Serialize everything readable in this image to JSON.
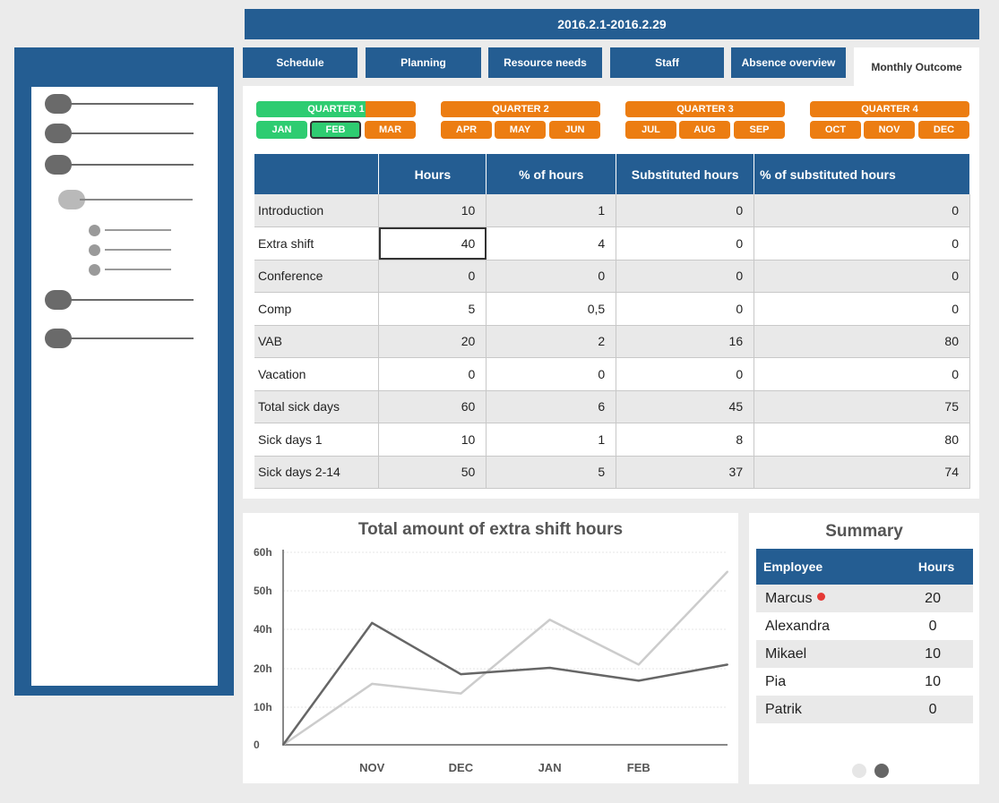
{
  "header": {
    "date_range": "2016.2.1-2016.2.29"
  },
  "tabs": [
    {
      "label": "Schedule"
    },
    {
      "label": "Planning"
    },
    {
      "label": "Resource needs"
    },
    {
      "label": "Staff"
    },
    {
      "label": "Absence overview"
    },
    {
      "label": "Monthly Outcome",
      "active": true
    }
  ],
  "quarters": [
    {
      "label": "QUARTER 1",
      "months": [
        "JAN",
        "FEB",
        "MAR"
      ]
    },
    {
      "label": "QUARTER 2",
      "months": [
        "APR",
        "MAY",
        "JUN"
      ]
    },
    {
      "label": "QUARTER 3",
      "months": [
        "JUL",
        "AUG",
        "SEP"
      ]
    },
    {
      "label": "QUARTER 4",
      "months": [
        "OCT",
        "NOV",
        "DEC"
      ]
    }
  ],
  "selected_month": "FEB",
  "colors": {
    "primary": "#245d92",
    "accent_orange": "#ec7d12",
    "active_green": "#2ecc71",
    "alert_red": "#e53935"
  },
  "table": {
    "columns": [
      "",
      "Hours",
      "% of hours",
      "Substituted hours",
      "% of substituted hours"
    ],
    "rows": [
      [
        "Introduction",
        "10",
        "1",
        "0",
        "0"
      ],
      [
        "Extra shift",
        "40",
        "4",
        "0",
        "0"
      ],
      [
        "Conference",
        "0",
        "0",
        "0",
        "0"
      ],
      [
        "Comp",
        "5",
        "0,5",
        "0",
        "0"
      ],
      [
        "VAB",
        "20",
        "2",
        "16",
        "80"
      ],
      [
        "Vacation",
        "0",
        "0",
        "0",
        "0"
      ],
      [
        "Total sick days",
        "60",
        "6",
        "45",
        "75"
      ],
      [
        "Sick days 1",
        "10",
        "1",
        "8",
        "80"
      ],
      [
        "Sick days 2-14",
        "50",
        "5",
        "37",
        "74"
      ]
    ]
  },
  "chart_data": {
    "type": "line",
    "title": "Total amount of extra shift hours",
    "categories": [
      "",
      "NOV",
      "DEC",
      "JAN",
      "FEB",
      ""
    ],
    "y_ticks": [
      "0",
      "10h",
      "20h",
      "40h",
      "50h",
      "60h"
    ],
    "ylim": [
      0,
      60
    ],
    "grid": true,
    "series": [
      {
        "color": "#666666",
        "values": [
          0,
          38,
          22,
          24,
          20,
          25
        ]
      },
      {
        "color": "#cccccc",
        "values": [
          0,
          19,
          16,
          39,
          25,
          54
        ]
      }
    ]
  },
  "summary": {
    "title": "Summary",
    "columns": [
      "Employee",
      "Hours"
    ],
    "rows": [
      {
        "name": "Marcus",
        "hours": "20",
        "alert": true
      },
      {
        "name": "Alexandra",
        "hours": "0"
      },
      {
        "name": "Mikael",
        "hours": "10"
      },
      {
        "name": "Pia",
        "hours": "10"
      },
      {
        "name": "Patrik",
        "hours": "0"
      }
    ],
    "pages": 2,
    "current_page": 2
  }
}
